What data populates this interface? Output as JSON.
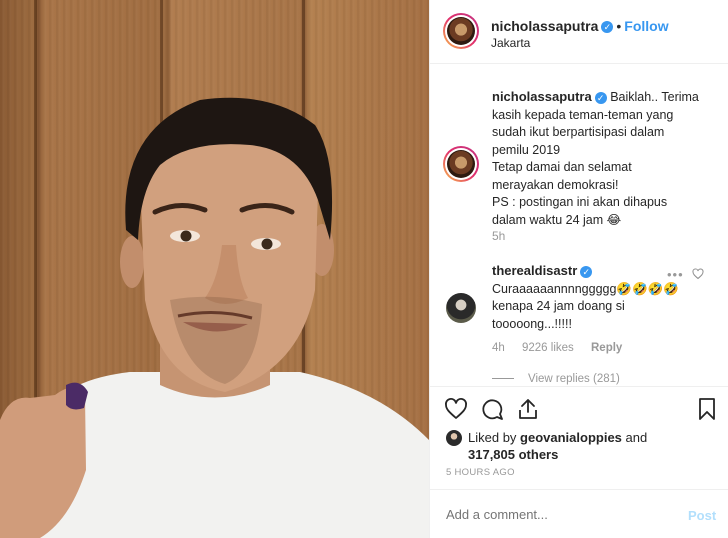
{
  "header": {
    "username": "nicholassaputra",
    "separator": "•",
    "follow_label": "Follow",
    "location": "Jakarta"
  },
  "caption": {
    "username": "nicholassaputra",
    "lines": [
      "Baiklah.. Terima",
      "kasih kepada teman-teman yang",
      "sudah ikut berpartisipasi dalam",
      "pemilu 2019",
      "Tetap damai dan selamat",
      "merayakan demokrasi!",
      "PS : postingan ini akan dihapus",
      "dalam waktu 24 jam 😂"
    ],
    "time": "5h"
  },
  "comment": {
    "username": "therealdisastr",
    "lines": [
      "Curaaaaaannnnggggg🤣🤣🤣🤣",
      "kenapa 24 jam doang si",
      "tooooong...!!!!!"
    ],
    "time": "4h",
    "likes": "9226 likes",
    "reply_label": "Reply",
    "more_icon": "•••",
    "view_replies": "View replies (281)"
  },
  "likes": {
    "prefix": "Liked by ",
    "user": "geovanialoppies",
    "middle": " and",
    "count": "317,805 others"
  },
  "timestamp": "5 HOURS AGO",
  "composer": {
    "placeholder": "Add a comment...",
    "post_label": "Post"
  },
  "colors": {
    "accent": "#3897f0",
    "post_disabled": "#b2dffc",
    "muted": "#999999"
  },
  "icons": [
    "heart-icon",
    "comment-icon",
    "share-icon",
    "bookmark-icon",
    "verified-icon"
  ]
}
